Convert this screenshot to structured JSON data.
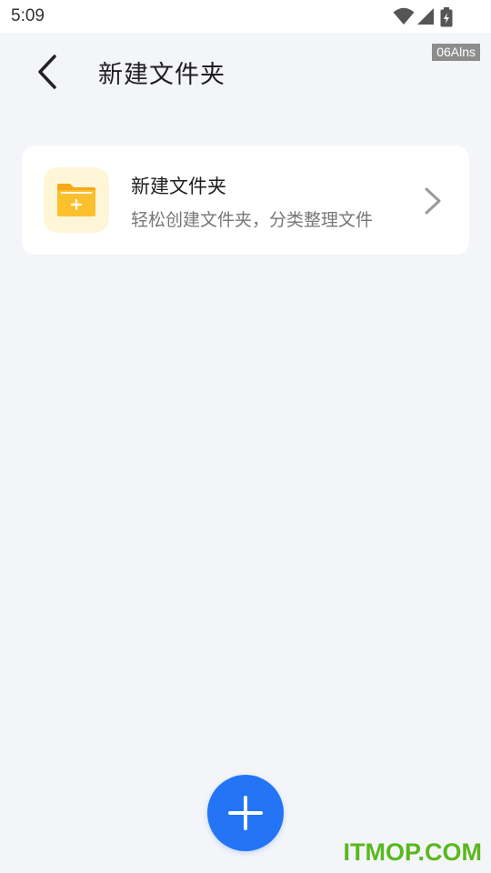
{
  "status_bar": {
    "time": "5:09",
    "icons": [
      "wifi-icon",
      "cellular-signal-icon",
      "battery-charging-icon"
    ]
  },
  "header": {
    "back_icon": "chevron-left-icon",
    "title": "新建文件夹",
    "badge": "06Alns"
  },
  "card": {
    "icon": "folder-plus-icon",
    "title": "新建文件夹",
    "subtitle": "轻松创建文件夹，分类整理文件",
    "chevron_icon": "chevron-right-icon"
  },
  "fab": {
    "icon": "plus-icon"
  },
  "watermark": "ITMOP.COM",
  "colors": {
    "background": "#f4f5f9",
    "card": "#ffffff",
    "fab": "#2375f5",
    "folder": "#f9b51b",
    "folder_bg": "#fff5d7",
    "watermark": "#5ab81e"
  }
}
